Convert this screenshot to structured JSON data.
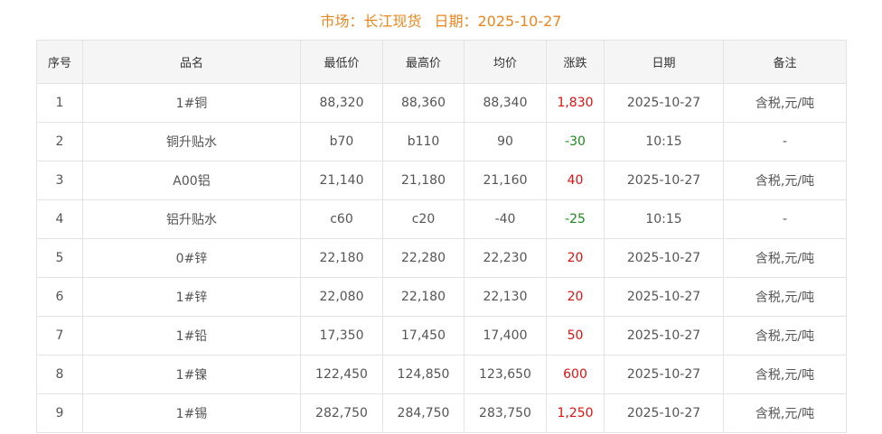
{
  "heading": {
    "market": "市场：长江现货",
    "date": "日期：2025-10-27"
  },
  "table": {
    "columns": [
      "序号",
      "品名",
      "最低价",
      "最高价",
      "均价",
      "涨跌",
      "日期",
      "备注"
    ],
    "rows": [
      {
        "no": "1",
        "name": "1#铜",
        "low": "88,320",
        "high": "88,360",
        "avg": "88,340",
        "change": "1,830",
        "trend": "up",
        "date": "2025-10-27",
        "note": "含税,元/吨"
      },
      {
        "no": "2",
        "name": "铜升贴水",
        "low": "b70",
        "high": "b110",
        "avg": "90",
        "change": "-30",
        "trend": "down",
        "date": "10:15",
        "note": "-"
      },
      {
        "no": "3",
        "name": "A00铝",
        "low": "21,140",
        "high": "21,180",
        "avg": "21,160",
        "change": "40",
        "trend": "up",
        "date": "2025-10-27",
        "note": "含税,元/吨"
      },
      {
        "no": "4",
        "name": "铝升贴水",
        "low": "c60",
        "high": "c20",
        "avg": "-40",
        "change": "-25",
        "trend": "down",
        "date": "10:15",
        "note": "-"
      },
      {
        "no": "5",
        "name": "0#锌",
        "low": "22,180",
        "high": "22,280",
        "avg": "22,230",
        "change": "20",
        "trend": "up",
        "date": "2025-10-27",
        "note": "含税,元/吨"
      },
      {
        "no": "6",
        "name": "1#锌",
        "low": "22,080",
        "high": "22,180",
        "avg": "22,130",
        "change": "20",
        "trend": "up",
        "date": "2025-10-27",
        "note": "含税,元/吨"
      },
      {
        "no": "7",
        "name": "1#铅",
        "low": "17,350",
        "high": "17,450",
        "avg": "17,400",
        "change": "50",
        "trend": "up",
        "date": "2025-10-27",
        "note": "含税,元/吨"
      },
      {
        "no": "8",
        "name": "1#镍",
        "low": "122,450",
        "high": "124,850",
        "avg": "123,650",
        "change": "600",
        "trend": "up",
        "date": "2025-10-27",
        "note": "含税,元/吨"
      },
      {
        "no": "9",
        "name": "1#锡",
        "low": "282,750",
        "high": "284,750",
        "avg": "283,750",
        "change": "1,250",
        "trend": "up",
        "date": "2025-10-27",
        "note": "含税,元/吨"
      }
    ]
  },
  "colors": {
    "heading": "#e8871e",
    "up": "#e01010",
    "down": "#1a8a1a"
  }
}
